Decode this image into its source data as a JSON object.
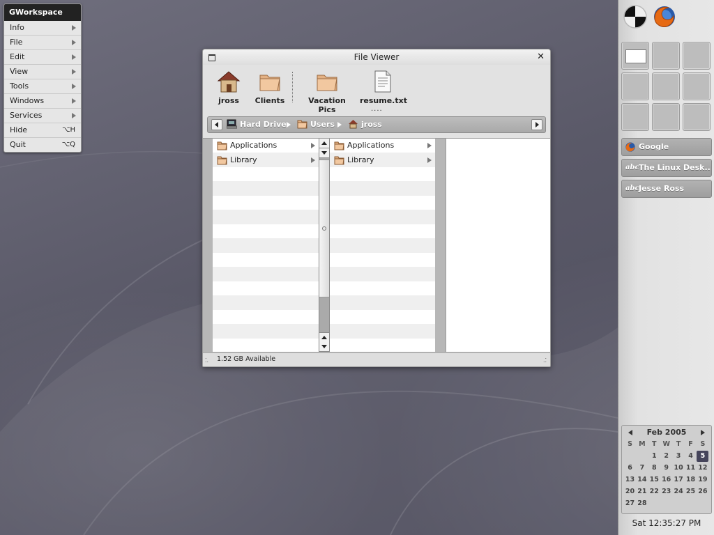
{
  "main_menu": {
    "title": "GWorkspace",
    "items": [
      {
        "label": "Info",
        "submenu": true
      },
      {
        "label": "File",
        "submenu": true
      },
      {
        "label": "Edit",
        "submenu": true
      },
      {
        "label": "View",
        "submenu": true
      },
      {
        "label": "Tools",
        "submenu": true
      },
      {
        "label": "Windows",
        "submenu": true
      },
      {
        "label": "Services",
        "submenu": true
      },
      {
        "label": "Hide",
        "shortcut": "⌥H"
      },
      {
        "label": "Quit",
        "shortcut": "⌥Q"
      }
    ]
  },
  "file_viewer": {
    "title": "File Viewer",
    "shelf": [
      {
        "label": "jross",
        "icon": "home-icon"
      },
      {
        "label": "Clients",
        "icon": "folder-icon"
      },
      {
        "label": "Vacation Pics",
        "icon": "folder-icon"
      },
      {
        "label": "resume.txt",
        "icon": "text-file-icon"
      }
    ],
    "shelf_ellipsis": "....",
    "path": [
      {
        "label": "Hard Drive",
        "icon": "computer-icon"
      },
      {
        "label": "Users",
        "icon": "folder-icon"
      },
      {
        "label": "jross",
        "icon": "home-icon"
      }
    ],
    "columns": [
      {
        "items": [
          "Applications",
          "Library"
        ]
      },
      {
        "items": [
          "Applications",
          "Library"
        ]
      },
      {
        "items": []
      }
    ],
    "status": "1.52 GB Available"
  },
  "dock": {
    "apps": [
      {
        "name": "gworkspace-icon"
      },
      {
        "name": "firefox-icon"
      }
    ],
    "workspaces": {
      "count": 9,
      "active": 1
    },
    "windows": [
      {
        "label": "Google",
        "icon": "firefox-icon"
      },
      {
        "label": "The Linux Desk...",
        "icon": "abc-text-icon",
        "icon_text": "abc"
      },
      {
        "label": "Jesse Ross",
        "icon": "abc-text-icon",
        "icon_text": "abc"
      }
    ],
    "calendar": {
      "month": "Feb 2005",
      "weekdays": [
        "S",
        "M",
        "T",
        "W",
        "T",
        "F",
        "S"
      ],
      "weeks": [
        [
          "",
          "",
          "1",
          "2",
          "3",
          "4",
          "5"
        ],
        [
          "6",
          "7",
          "8",
          "9",
          "10",
          "11",
          "12"
        ],
        [
          "13",
          "14",
          "15",
          "16",
          "17",
          "18",
          "19"
        ],
        [
          "20",
          "21",
          "22",
          "23",
          "24",
          "25",
          "26"
        ],
        [
          "27",
          "28",
          "",
          "",
          "",
          "",
          ""
        ]
      ],
      "today": "5"
    },
    "clock": "Sat 12:35:27 PM"
  },
  "colors": {
    "desktop": "#5b5a6a",
    "menu_title_bg": "#222222",
    "calendar_today": "#45445a"
  }
}
